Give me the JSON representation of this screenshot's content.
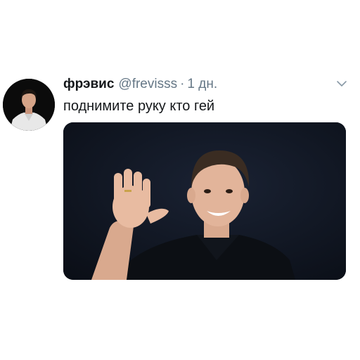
{
  "tweet": {
    "display_name": "фрэвис",
    "handle": "@frevisss",
    "separator": "·",
    "time": "1 дн.",
    "text": "поднимите руку кто гей"
  },
  "icons": {
    "more": "chevron-down-icon"
  },
  "colors": {
    "text_primary": "#14171a",
    "text_secondary": "#657786",
    "background": "#ffffff",
    "media_background": "#0e131d"
  }
}
